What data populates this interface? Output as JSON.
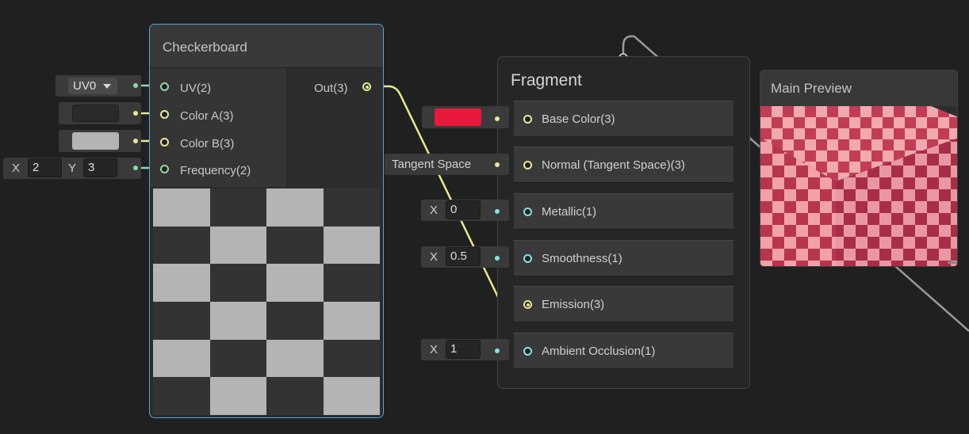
{
  "checkerboard_node": {
    "title": "Checkerboard",
    "inputs": [
      "UV(2)",
      "Color A(3)",
      "Color B(3)",
      "Frequency(2)"
    ],
    "output": "Out(3)",
    "uv_dropdown": "UV0",
    "frequency": {
      "x_label": "X",
      "x_value": "2",
      "y_label": "Y",
      "y_value": "3"
    },
    "color_a": "#2a2a2a",
    "color_b": "#b4b4b4"
  },
  "fragment_node": {
    "title": "Fragment",
    "slots": [
      "Base Color(3)",
      "Normal (Tangent Space)(3)",
      "Metallic(1)",
      "Smoothness(1)",
      "Emission(3)",
      "Ambient Occlusion(1)"
    ],
    "base_color_swatch": "#e8193c",
    "normal_space": "Tangent Space",
    "metallic": {
      "label": "X",
      "value": "0"
    },
    "smoothness": {
      "label": "X",
      "value": "0.5"
    },
    "ambient_occlusion": {
      "label": "X",
      "value": "1"
    }
  },
  "main_preview": {
    "title": "Main Preview",
    "checker_colors": [
      "#c23c55",
      "#f2a9ad"
    ]
  },
  "colors": {
    "selection": "#4ea7db",
    "vector2_port": "#8fd9a8",
    "vector3_port": "#e8e89a",
    "float_port": "#84e4e7"
  }
}
